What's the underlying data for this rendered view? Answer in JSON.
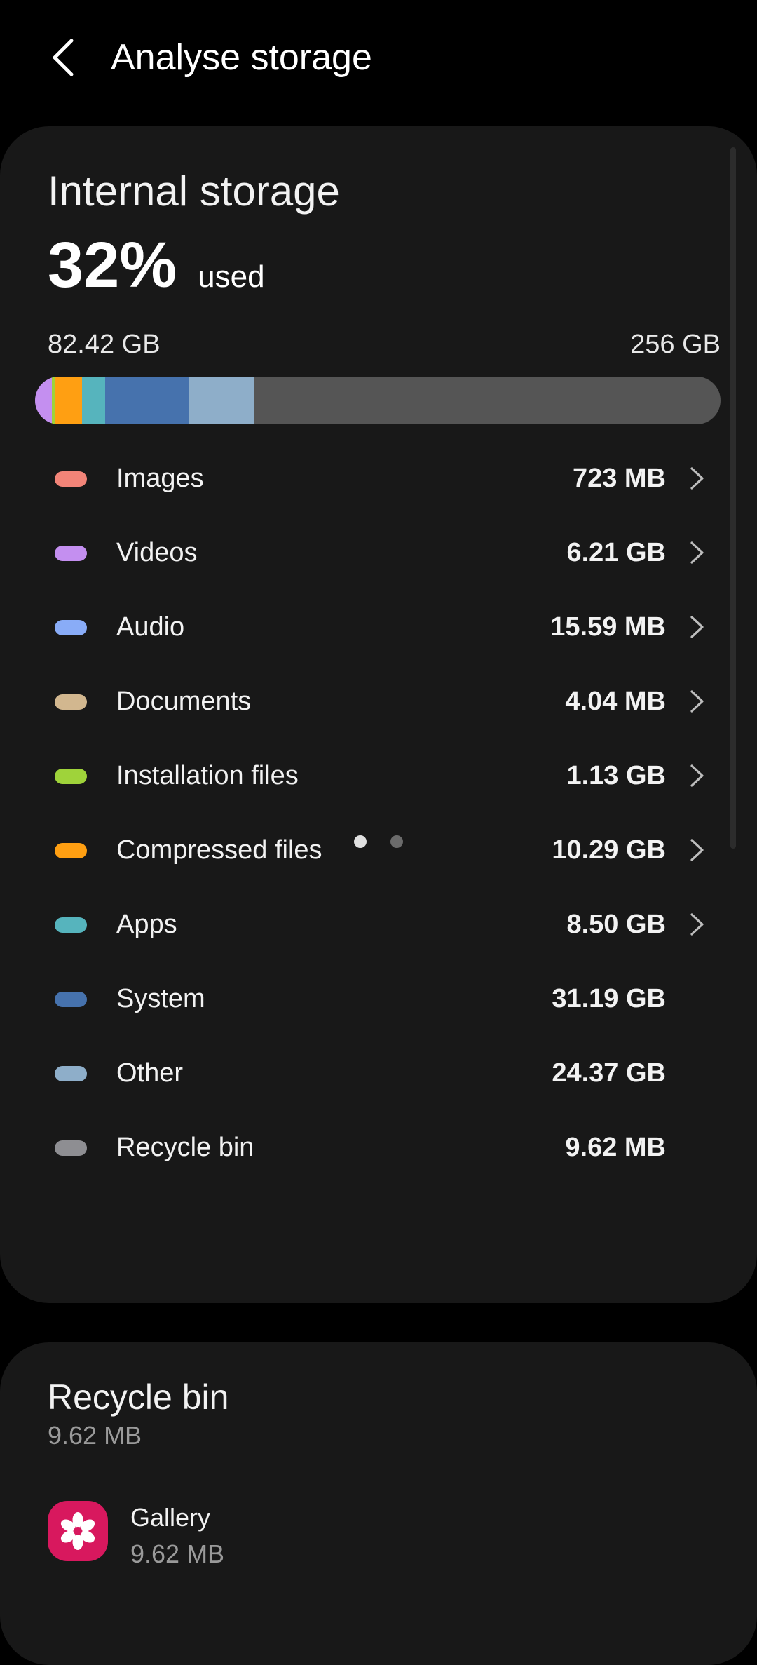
{
  "header": {
    "title": "Analyse storage",
    "back_icon": "chevron-left-icon"
  },
  "storage": {
    "heading": "Internal storage",
    "percent_used": "32%",
    "used_suffix": "used",
    "used_amount": "82.42 GB",
    "total_amount": "256 GB",
    "usage_fraction": 0.32,
    "bar_segments": [
      {
        "name": "Videos",
        "fraction": 0.0243,
        "color": "#c48ff0"
      },
      {
        "name": "Installation files",
        "fraction": 0.0044,
        "color": "#9fd33a"
      },
      {
        "name": "Compressed files",
        "fraction": 0.0402,
        "color": "#ff9f12"
      },
      {
        "name": "Apps",
        "fraction": 0.0332,
        "color": "#56b4bd"
      },
      {
        "name": "System",
        "fraction": 0.1218,
        "color": "#4672ad"
      },
      {
        "name": "Other",
        "fraction": 0.0952,
        "color": "#8eaec9"
      }
    ]
  },
  "categories": [
    {
      "label": "Images",
      "size": "723 MB",
      "color": "#f28478",
      "chevron": true
    },
    {
      "label": "Videos",
      "size": "6.21 GB",
      "color": "#c48ff0",
      "chevron": true
    },
    {
      "label": "Audio",
      "size": "15.59 MB",
      "color": "#89acf7",
      "chevron": true
    },
    {
      "label": "Documents",
      "size": "4.04 MB",
      "color": "#d2b78f",
      "chevron": true
    },
    {
      "label": "Installation files",
      "size": "1.13 GB",
      "color": "#9fd33a",
      "chevron": true
    },
    {
      "label": "Compressed files",
      "size": "10.29 GB",
      "color": "#ff9f12",
      "chevron": true
    },
    {
      "label": "Apps",
      "size": "8.50 GB",
      "color": "#56b4bd",
      "chevron": true
    },
    {
      "label": "System",
      "size": "31.19 GB",
      "color": "#4672ad",
      "chevron": false
    },
    {
      "label": "Other",
      "size": "24.37 GB",
      "color": "#8eaec9",
      "chevron": false
    },
    {
      "label": "Recycle bin",
      "size": "9.62 MB",
      "color": "#8e8e92",
      "chevron": false
    }
  ],
  "pager": {
    "count": 2,
    "active_index": 0,
    "active_color": "#e0e0e0",
    "inactive_color": "#6b6b6b"
  },
  "recycle_bin": {
    "title": "Recycle bin",
    "size": "9.62 MB",
    "apps": [
      {
        "name": "Gallery",
        "size": "9.62 MB",
        "icon": "gallery-flower-icon",
        "icon_color": "#d8185e"
      }
    ]
  }
}
